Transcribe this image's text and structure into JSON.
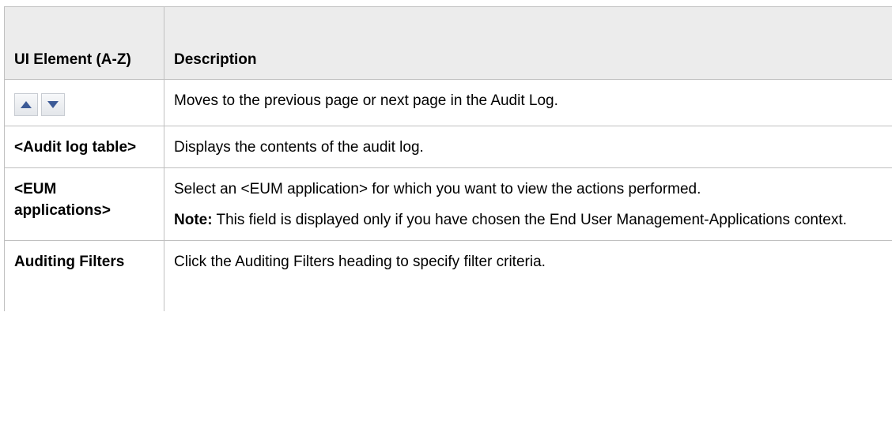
{
  "table": {
    "headers": {
      "element": "UI Element (A-Z)",
      "description": "Description"
    },
    "rows": [
      {
        "element_icons": [
          "arrow-up-icon",
          "arrow-down-icon"
        ],
        "description": "Moves to the previous page or next page in the Audit Log."
      },
      {
        "element": "<Audit log table>",
        "description": "Displays the contents of the audit log."
      },
      {
        "element": "<EUM applications>",
        "description": "Select an <EUM application> for which you want to view the actions performed.",
        "note_label": "Note:",
        "note_text": " This field is displayed only if you have chosen the End User Management-Applications context."
      },
      {
        "element": "Auditing Filters",
        "description": "Click the Auditing Filters heading to specify filter criteria."
      }
    ]
  },
  "colors": {
    "header_bg": "#ececec",
    "border": "#c0c0c0",
    "arrow": "#3c5a96"
  }
}
